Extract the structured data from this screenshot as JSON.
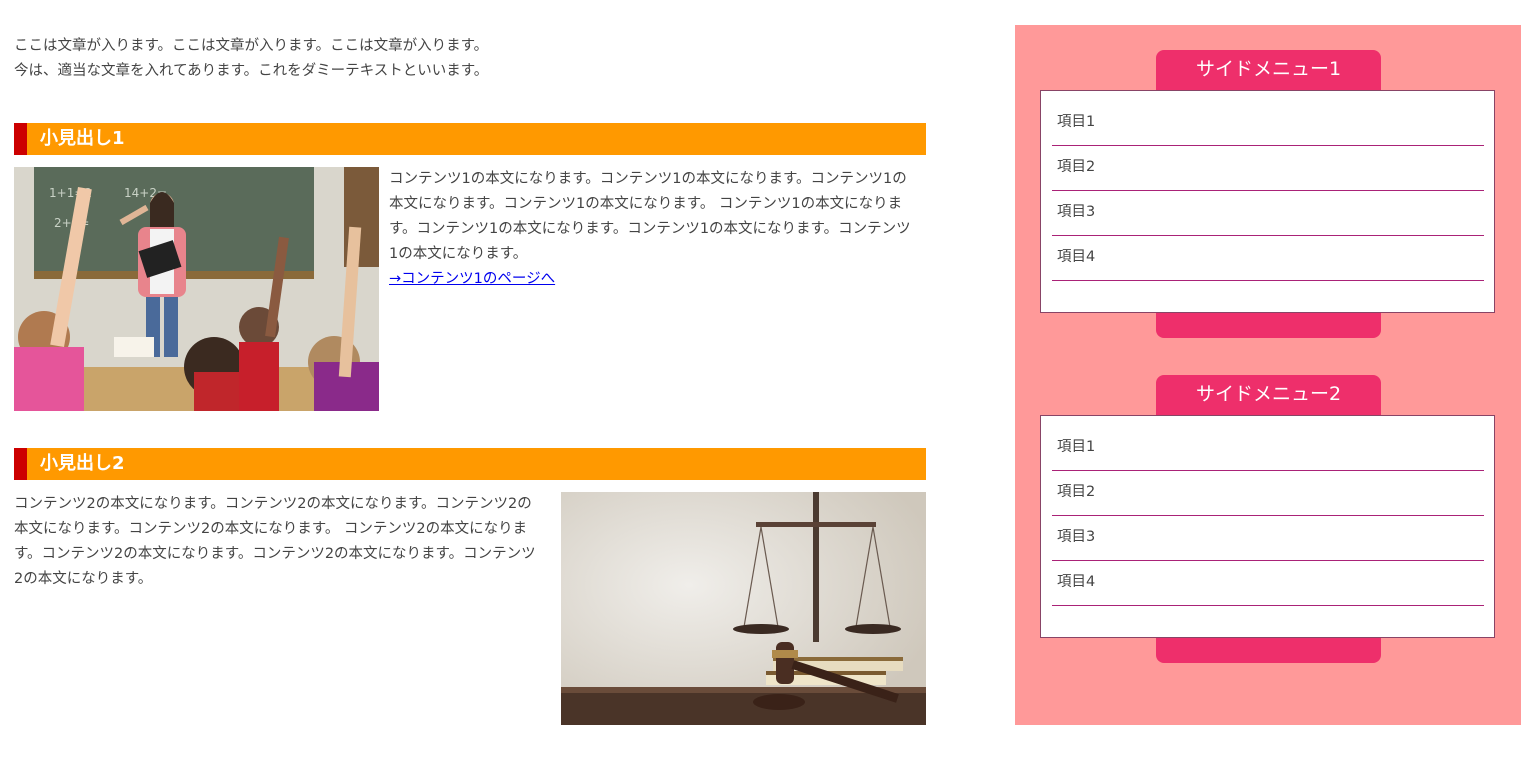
{
  "intro": {
    "line1": "ここは文章が入ります。ここは文章が入ります。ここは文章が入ります。",
    "line2": "今は、適当な文章を入れてあります。これをダミーテキストといいます。"
  },
  "sections": [
    {
      "heading": "小見出し1",
      "body": "コンテンツ1の本文になります。コンテンツ1の本文になります。コンテンツ1の本文になります。コンテンツ1の本文になります。 コンテンツ1の本文になります。コンテンツ1の本文になります。コンテンツ1の本文になります。コンテンツ1の本文になります。",
      "link": "→コンテンツ1のページへ",
      "image": "classroom-photo"
    },
    {
      "heading": "小見出し2",
      "body": "コンテンツ2の本文になります。コンテンツ2の本文になります。コンテンツ2の本文になります。コンテンツ2の本文になります。 コンテンツ2の本文になります。コンテンツ2の本文になります。コンテンツ2の本文になります。コンテンツ2の本文になります。",
      "image": "scales-gavel-photo"
    }
  ],
  "sidebar": {
    "menus": [
      {
        "title": "サイドメニュー1",
        "items": [
          "項目1",
          "項目2",
          "項目3",
          "項目4"
        ]
      },
      {
        "title": "サイドメニュー2",
        "items": [
          "項目1",
          "項目2",
          "項目3",
          "項目4"
        ]
      }
    ]
  },
  "colors": {
    "heading_bg": "#ff9900",
    "heading_accent": "#cc0000",
    "sidebar_bg": "#ff9999",
    "menu_tab": "#ee2f6b"
  }
}
